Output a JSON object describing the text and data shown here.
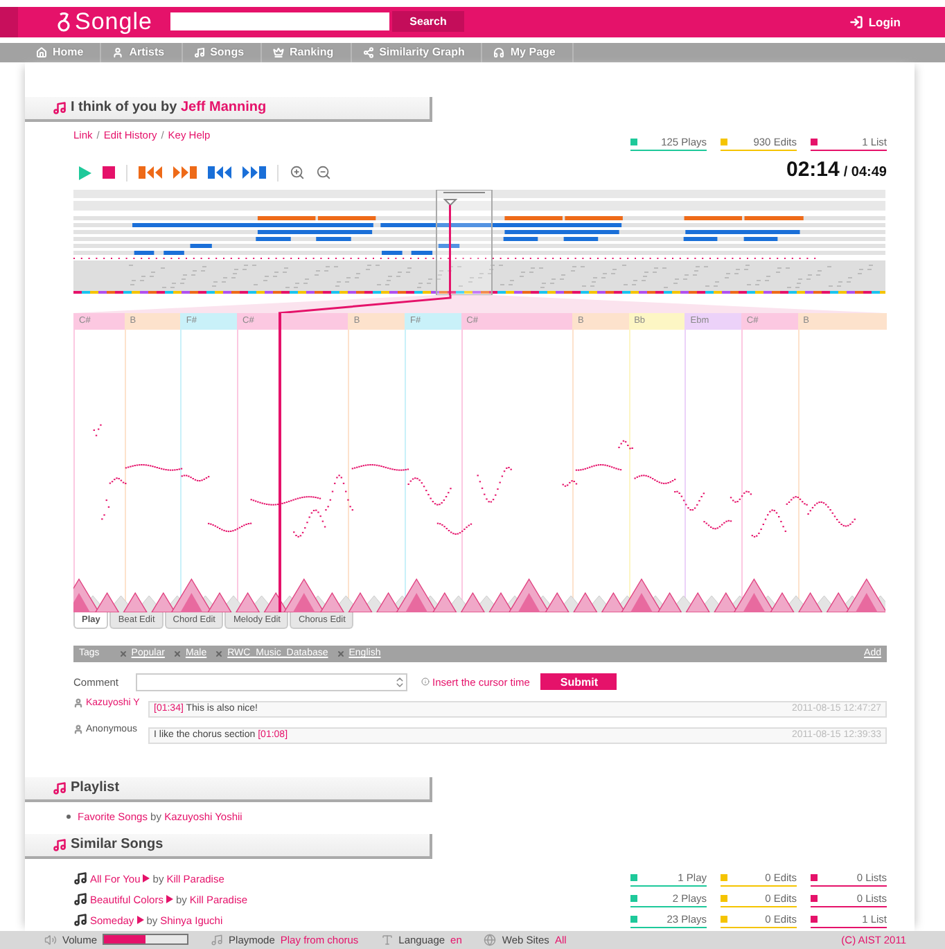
{
  "header": {
    "logo": "Songle",
    "search_button": "Search",
    "login": "Login"
  },
  "nav": [
    {
      "label": "Home"
    },
    {
      "label": "Artists"
    },
    {
      "label": "Songs"
    },
    {
      "label": "Ranking"
    },
    {
      "label": "Similarity Graph"
    },
    {
      "label": "My Page"
    }
  ],
  "song": {
    "title": "I think of you",
    "by": "by",
    "artist": "Jeff Manning"
  },
  "links": [
    "Link",
    "Edit History",
    "Key Help"
  ],
  "link_separator": "/",
  "stats": [
    {
      "text": "125 Plays",
      "color": "#1ec99a"
    },
    {
      "text": "930 Edits",
      "color": "#f5c400"
    },
    {
      "text": "1 List",
      "color": "#e5126a"
    }
  ],
  "time": {
    "current": "02:14",
    "total": "/ 04:49"
  },
  "chords": [
    {
      "label": "C#",
      "color": "#fcc8e1"
    },
    {
      "label": "B",
      "color": "#fde2cc"
    },
    {
      "label": "F#",
      "color": "#c9f1f9"
    },
    {
      "label": "C#",
      "color": "#fcc8e1"
    },
    {
      "label": "B",
      "color": "#fde2cc"
    },
    {
      "label": "F#",
      "color": "#c9f1f9"
    },
    {
      "label": "C#",
      "color": "#fcc8e1"
    },
    {
      "label": "B",
      "color": "#fde2cc"
    },
    {
      "label": "Bb",
      "color": "#fdf6c4"
    },
    {
      "label": "Ebm",
      "color": "#ecd2f9"
    },
    {
      "label": "C#",
      "color": "#fcc8e1"
    },
    {
      "label": "B",
      "color": "#fde2cc"
    }
  ],
  "tabs": [
    {
      "label": "Play",
      "selected": true
    },
    {
      "label": "Beat Edit",
      "selected": false
    },
    {
      "label": "Chord Edit",
      "selected": false
    },
    {
      "label": "Melody Edit",
      "selected": false
    },
    {
      "label": "Chorus Edit",
      "selected": false
    }
  ],
  "tags": {
    "label": "Tags",
    "items": [
      "Popular",
      "Male",
      "RWC_Music_Database",
      "English"
    ],
    "add": "Add"
  },
  "comment_form": {
    "label": "Comment",
    "insert": "Insert the cursor time",
    "submit": "Submit"
  },
  "comments": [
    {
      "user": "Kazuyoshi Y",
      "kind": "member",
      "parts": [
        {
          "kind": "time",
          "text": "[01:34]"
        },
        {
          "kind": "text",
          "text": "This is also nice!"
        }
      ],
      "date": "2011-08-15 12:47:27"
    },
    {
      "user": "Anonymous",
      "kind": "guest",
      "parts": [
        {
          "kind": "text",
          "text": "I like the chorus section"
        },
        {
          "kind": "time",
          "text": "[01:08]"
        }
      ],
      "date": "2011-08-15 12:39:33"
    }
  ],
  "playlist": {
    "heading": "Playlist",
    "items": [
      {
        "title": "Favorite Songs",
        "by": "by",
        "owner": "Kazuyoshi Yoshii"
      }
    ]
  },
  "similar": {
    "heading": "Similar Songs",
    "items": [
      {
        "title": "All For You",
        "by": "by",
        "artist": "Kill Paradise",
        "stats": [
          "1 Play",
          "0 Edits",
          "0 Lists"
        ]
      },
      {
        "title": "Beautiful Colors",
        "by": "by",
        "artist": "Kill Paradise",
        "stats": [
          "2 Plays",
          "0 Edits",
          "0 Lists"
        ]
      },
      {
        "title": "Someday",
        "by": "by",
        "artist": "Shinya Iguchi",
        "stats": [
          "23 Plays",
          "0 Edits",
          "1 List"
        ]
      }
    ]
  },
  "footer": {
    "volume": {
      "label": "Volume",
      "level": 0.5
    },
    "playmode": {
      "label": "Playmode",
      "value": "Play from chorus"
    },
    "language": {
      "label": "Language",
      "value": "en"
    },
    "websites": {
      "label": "Web Sites",
      "value": "All"
    },
    "copyright": "(C) AIST 2011"
  }
}
